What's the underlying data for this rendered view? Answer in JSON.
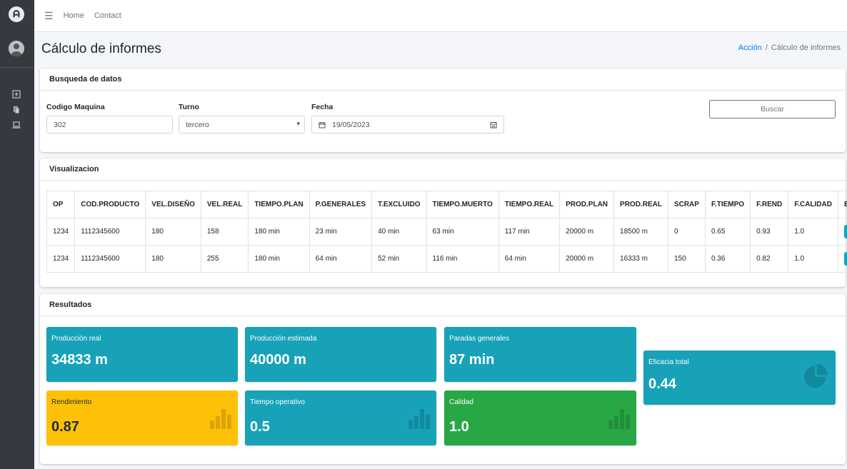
{
  "nav": {
    "home": "Home",
    "contact": "Contact"
  },
  "page": {
    "title": "Cálculo de informes"
  },
  "breadcrumb": {
    "parent": "Acción",
    "separator": "/",
    "current": "Cálculo de informes"
  },
  "search": {
    "header": "Busqueda de datos",
    "machine_label": "Codigo Maquina",
    "machine_value": "302",
    "shift_label": "Turno",
    "shift_value": "tercero",
    "date_label": "Fecha",
    "date_value": "19/05/2023",
    "search_button": "Buscar"
  },
  "visualization": {
    "header": "Visualizacion",
    "columns": [
      "OP",
      "COD.PRODUCTO",
      "VEL.DISEÑO",
      "VEL.REAL",
      "TIEMPO.PLAN",
      "P.GENERALES",
      "T.EXCLUIDO",
      "TIEMPO.MUERTO",
      "TIEMPO.REAL",
      "PROD.PLAN",
      "PROD.REAL",
      "SCRAP",
      "F.TIEMPO",
      "F.REND",
      "F.CALIDAD",
      "EDI"
    ],
    "rows": [
      [
        "1234",
        "1112345600",
        "180",
        "158",
        "180 min",
        "23 min",
        "40 min",
        "63 min",
        "117 min",
        "20000 m",
        "18500 m",
        "0",
        "0.65",
        "0.93",
        "1.0"
      ],
      [
        "1234",
        "1112345600",
        "180",
        "255",
        "180 min",
        "64 min",
        "52 min",
        "116 min",
        "64 min",
        "20000 m",
        "16333 m",
        "150",
        "0.36",
        "0.82",
        "1.0"
      ]
    ]
  },
  "results": {
    "header": "Resultados",
    "prod_real": {
      "label": "Producción real",
      "value": "34833 m"
    },
    "prod_est": {
      "label": "Producción estimada",
      "value": "40000 m"
    },
    "paradas": {
      "label": "Paradas generales",
      "value": "87 min"
    },
    "eficacia": {
      "label": "Eficacia total",
      "value": "0.44"
    },
    "rendimiento": {
      "label": "Rendimiento",
      "value": "0.87"
    },
    "tiempo_op": {
      "label": "Tiempo operativo",
      "value": "0.5"
    },
    "calidad": {
      "label": "Calidad",
      "value": "1.0"
    }
  },
  "colors": {
    "info": "#17a2b8",
    "warning": "#ffc107",
    "success": "#28a745",
    "sidebar": "#343a40",
    "link": "#007bff"
  }
}
